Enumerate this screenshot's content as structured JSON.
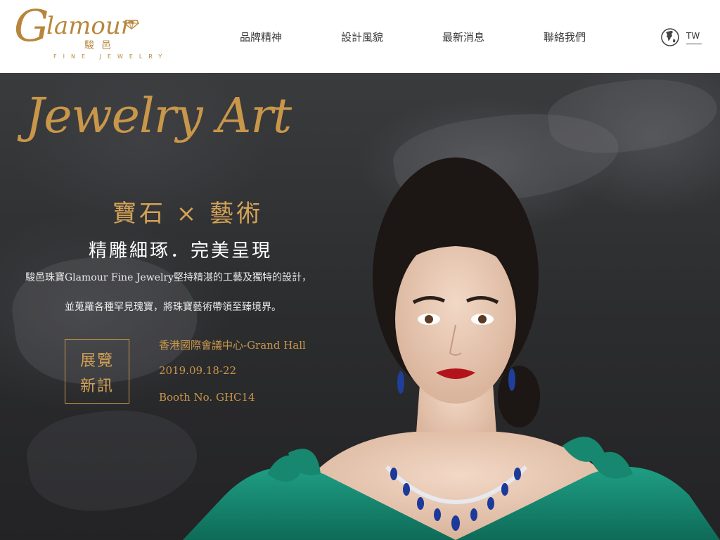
{
  "brand": {
    "name_script": "Glamour",
    "name_initial": "G",
    "name_rest": "lamour",
    "name_cn": "駿邑",
    "tagline": "FINE JEWELRY",
    "accent_color": "#b8863b"
  },
  "nav": {
    "items": [
      {
        "label": "品牌精神"
      },
      {
        "label": "設計風貌"
      },
      {
        "label": "最新消息"
      },
      {
        "label": "聯絡我們"
      }
    ],
    "language": "TW",
    "language_icon": "globe-icon"
  },
  "hero": {
    "title_script": "Jewelry Art",
    "headline1": "寶石 × 藝術",
    "headline2": "精雕細琢．完美呈現",
    "description_line1": "駿邑珠寶Glamour Fine Jewelry堅持精湛的工藝及獨特的設計，",
    "description_line2": "並蒐羅各種罕見瑰寶，將珠寶藝術帶領至臻境界。",
    "exhibition": {
      "button_line1": "展覽",
      "button_line2": "新訊",
      "venue": "香港國際會議中心-Grand Hall",
      "date": "2019.09.18-22",
      "booth": "Booth No. GHC14"
    },
    "gold_color": "#c9974a"
  }
}
